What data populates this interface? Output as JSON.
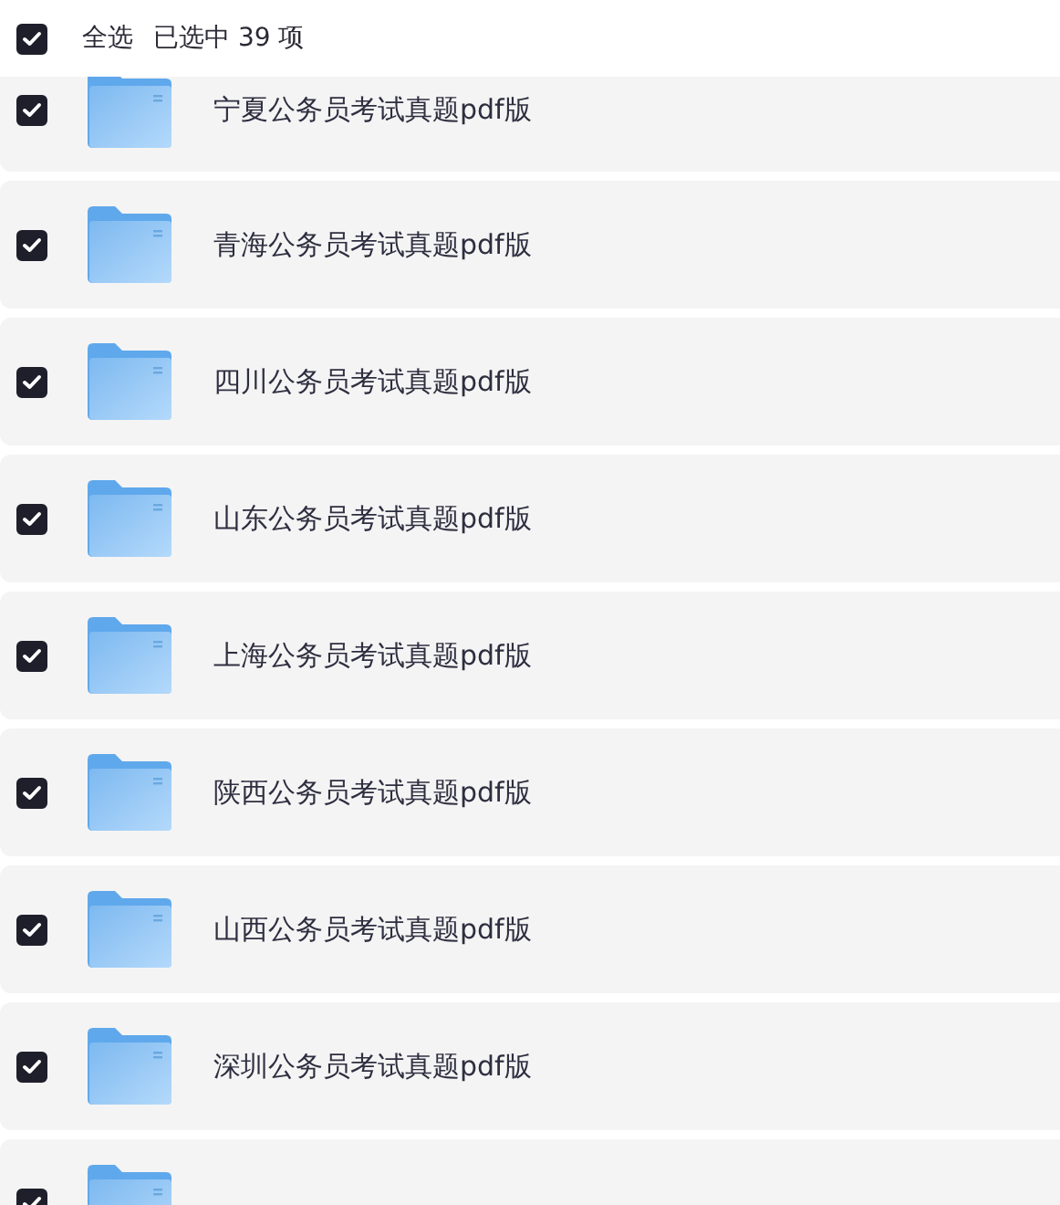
{
  "header": {
    "select_all": {
      "label": "全选",
      "checked": true
    },
    "selection_text": "已选中 39 项"
  },
  "items": [
    {
      "name": "宁夏公务员考试真题pdf版",
      "checked": true
    },
    {
      "name": "青海公务员考试真题pdf版",
      "checked": true
    },
    {
      "name": "四川公务员考试真题pdf版",
      "checked": true
    },
    {
      "name": "山东公务员考试真题pdf版",
      "checked": true
    },
    {
      "name": "上海公务员考试真题pdf版",
      "checked": true
    },
    {
      "name": "陕西公务员考试真题pdf版",
      "checked": true
    },
    {
      "name": "山西公务员考试真题pdf版",
      "checked": true
    },
    {
      "name": "深圳公务员考试真题pdf版",
      "checked": true
    },
    {
      "checked": true
    }
  ]
}
